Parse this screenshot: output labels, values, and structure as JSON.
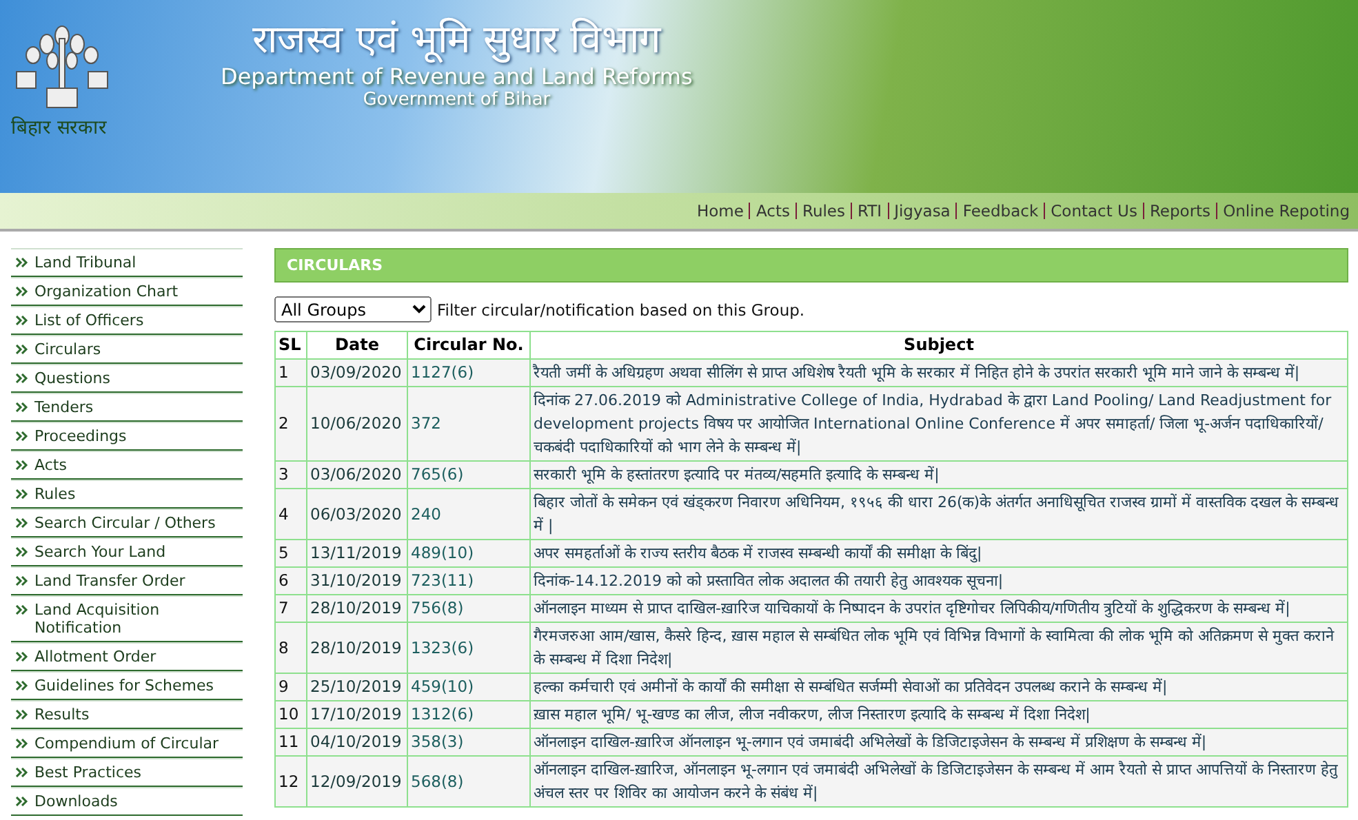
{
  "header": {
    "title_hindi": "राजस्व एवं भूमि सुधार विभाग",
    "title_english": "Department of Revenue and Land Reforms",
    "subtitle": "Government of Bihar",
    "emblem_caption": "बिहार सरकार"
  },
  "nav": [
    "Home",
    "Acts",
    "Rules",
    "RTI",
    "Jigyasa",
    "Feedback",
    "Contact Us",
    "Reports",
    "Online Repoting"
  ],
  "sidebar": {
    "items": [
      "Land Tribunal",
      "Organization Chart",
      "List of Officers",
      "Circulars",
      "Questions",
      "Tenders",
      "Proceedings",
      "Acts",
      "Rules",
      "Search Circular / Others",
      "Search Your Land",
      "Land Transfer Order",
      "Land Acquisition Notification",
      "Allotment Order",
      "Guidelines for Schemes",
      "Results",
      "Compendium of Circular",
      "Best Practices",
      "Downloads"
    ]
  },
  "section_title": "CIRCULARS",
  "filter": {
    "value": "All Groups",
    "hint": "Filter circular/notification based on this Group."
  },
  "table": {
    "columns": [
      "SL",
      "Date",
      "Circular No.",
      "Subject"
    ],
    "rows": [
      [
        "1",
        "03/09/2020",
        "1127(6)",
        "रैयती जमीं के अधिग्रहण अथवा सीलिंग से प्राप्त अधिशेष रैयती भूमि के सरकार में निहित होने के उपरांत सरकारी भूमि माने जाने के सम्बन्ध में|"
      ],
      [
        "2",
        "10/06/2020",
        "372",
        "दिनांक 27.06.2019 को Administrative College of India, Hydrabad के द्वारा Land Pooling/ Land Readjustment for development projects विषय पर आयोजित International Online Conference में अपर समाहर्ता/ जिला भू-अर्जन पदाधिकारियों/चकबंदी पदाधिकारियों को भाग लेने के सम्बन्ध में|"
      ],
      [
        "3",
        "03/06/2020",
        "765(6)",
        "सरकारी भूमि के हस्तांतरण इत्यादि पर मंतव्य/सहमति इत्यादि के सम्बन्ध में|"
      ],
      [
        "4",
        "06/03/2020",
        "240",
        "बिहार जोतों के समेकन एवं खंड्करण निवारण अधिनियम, १९५६ की धारा 26(क)के अंतर्गत अनाधिसूचित राजस्व ग्रामों में वास्तविक दखल के सम्बन्ध में |"
      ],
      [
        "5",
        "13/11/2019",
        "489(10)",
        "अपर समहर्ताओं के राज्य स्तरीय बैठक में राजस्व सम्बन्धी कार्यों की समीक्षा के बिंदु|"
      ],
      [
        "6",
        "31/10/2019",
        "723(11)",
        "दिनांक-14.12.2019 को को प्रस्तावित लोक अदालत की तयारी हेतु आवश्यक सूचना|"
      ],
      [
        "7",
        "28/10/2019",
        "756(8)",
        "ऑनलाइन माध्यम से प्राप्त दाखिल-ख़ारिज याचिकायों के निष्पादन के उपरांत दृष्टिगोचर लिपिकीय/गणितीय त्रुटियों के शुद्धिकरण के सम्बन्ध में|"
      ],
      [
        "8",
        "28/10/2019",
        "1323(6)",
        "गैरमजरुआ आम/खास, कैसरे हिन्द, ख़ास महाल से सम्बंधित लोक भूमि एवं विभिन्न विभागों के स्वामित्वा की लोक भूमि को अतिक्रमण से मुक्त कराने के सम्बन्ध में दिशा निदेश|"
      ],
      [
        "9",
        "25/10/2019",
        "459(10)",
        "हल्का कर्मचारी एवं अमीनों के कार्यों की समीक्षा से सम्बंधित सर्जम्मी सेवाओं का प्रतिवेदन उपलब्ध कराने के सम्बन्ध में|"
      ],
      [
        "10",
        "17/10/2019",
        "1312(6)",
        "ख़ास महाल भूमि/ भू-खण्ड का लीज, लीज नवीकरण, लीज निस्तारण इत्यादि के सम्बन्ध में दिशा निदेश|"
      ],
      [
        "11",
        "04/10/2019",
        "358(3)",
        "ऑनलाइन दाखिल-ख़ारिज ऑनलाइन भू-लगान एवं जमाबंदी अभिलेखों के डिजिटाइजेसन के सम्बन्ध में प्रशिक्षण के सम्बन्ध में|"
      ],
      [
        "12",
        "12/09/2019",
        "568(8)",
        "ऑनलाइन दाखिल-ख़ारिज, ऑनलाइन भू-लगान एवं जमाबंदी अभिलेखों के डिजिटाइजेसन के सम्बन्ध में आम रैयतो से प्राप्त आपत्तियों के निस्तारण हेतु अंचल स्तर पर शिविर का आयोजन करने के संबंध में|"
      ]
    ]
  }
}
